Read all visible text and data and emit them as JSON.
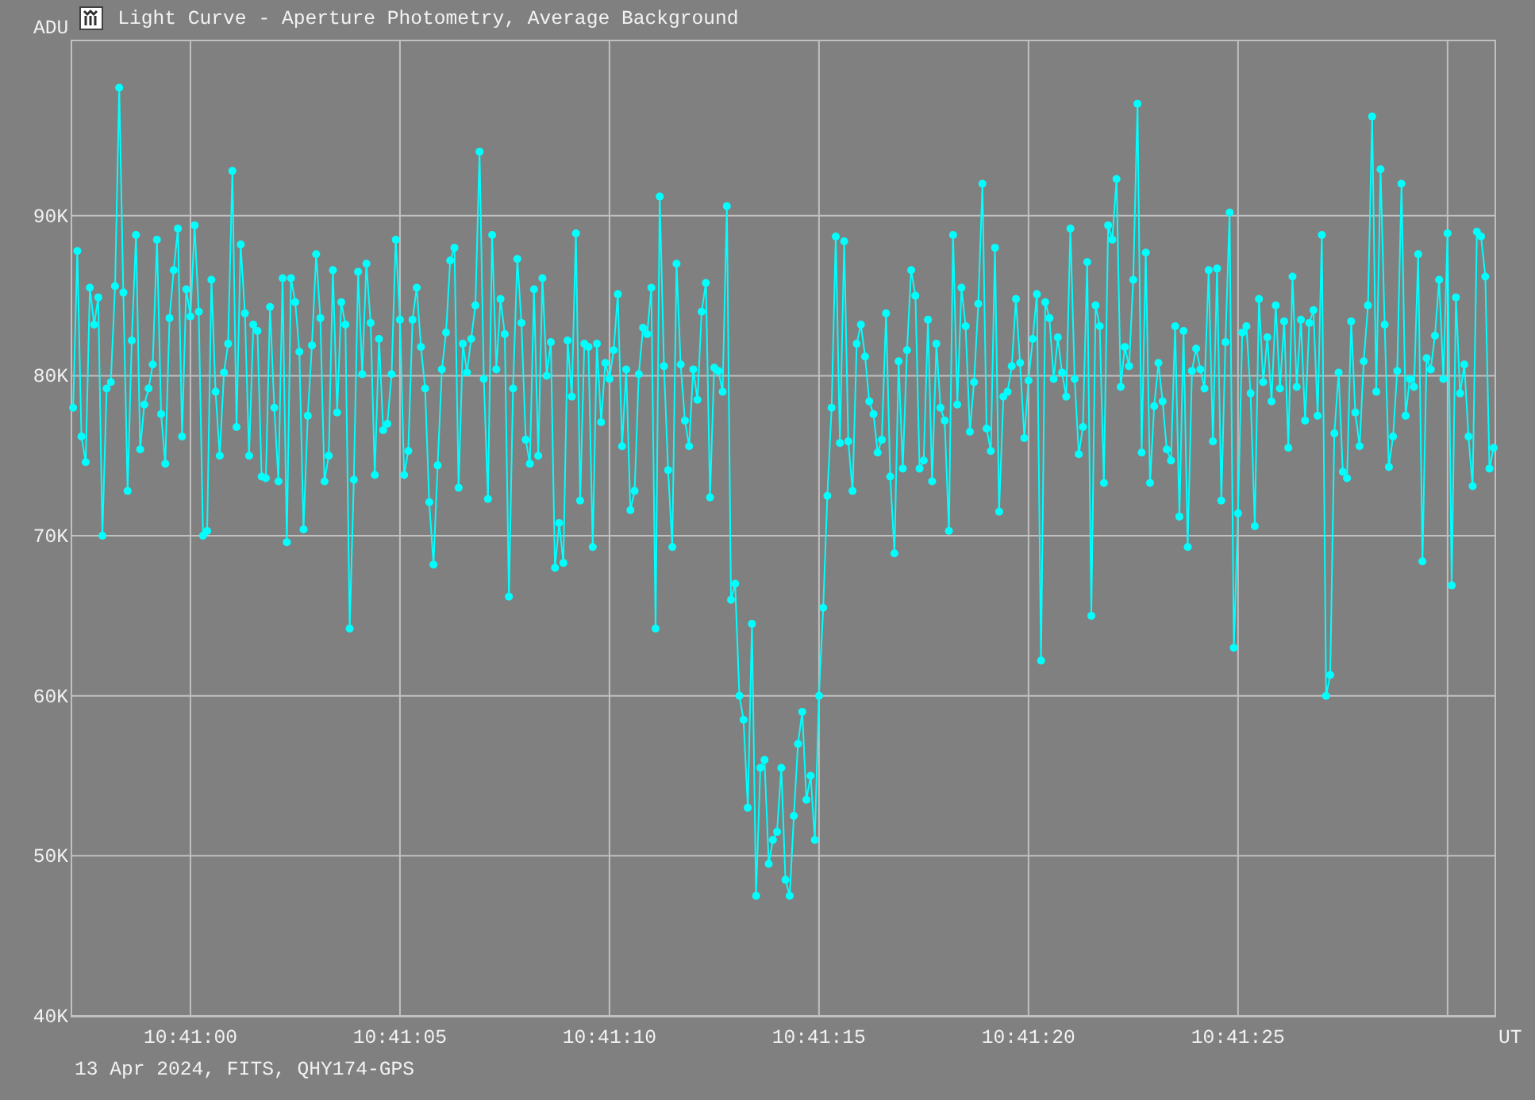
{
  "window": {
    "title": "Light Curve - Aperture Photometry, Average Background"
  },
  "chart": {
    "chart_data": {
      "type": "line",
      "xlabel": "UT",
      "ylabel": "ADU",
      "grid": true,
      "series": [
        {
          "color": "#00ffff",
          "marker": "circle",
          "values": [
            78000,
            87800,
            76200,
            74600,
            85500,
            83200,
            84900,
            70000,
            79200,
            79600,
            85600,
            98000,
            85200,
            72800,
            82200,
            88800,
            75400,
            78200,
            79200,
            80700,
            88500,
            77600,
            74500,
            83600,
            86600,
            89200,
            76200,
            85400,
            83700,
            89400,
            84000,
            70000,
            70300,
            86000,
            79000,
            75000,
            80200,
            82000,
            92800,
            76800,
            88200,
            83900,
            75000,
            83200,
            82800,
            73700,
            73600,
            84300,
            78000,
            73400,
            86100,
            69600,
            86100,
            84600,
            81500,
            70400,
            77500,
            81900,
            87600,
            83600,
            73400,
            75000,
            86600,
            77700,
            84600,
            83200,
            64200,
            73500,
            86500,
            80100,
            87000,
            83300,
            73800,
            82300,
            76600,
            77000,
            80100,
            88500,
            83500,
            73800,
            75300,
            83500,
            85500,
            81800,
            79200,
            72100,
            68200,
            74400,
            80400,
            82700,
            87200,
            88000,
            73000,
            82000,
            80200,
            82300,
            84400,
            94000,
            79800,
            72300,
            88800,
            80400,
            84800,
            82600,
            66200,
            79200,
            87300,
            83300,
            76000,
            74500,
            85400,
            75000,
            86100,
            80000,
            82100,
            68000,
            70800,
            68300,
            82200,
            78700,
            88900,
            72200,
            82000,
            81800,
            69300,
            82000,
            77100,
            80800,
            79800,
            81600,
            85100,
            75600,
            80400,
            71600,
            72800,
            80100,
            83000,
            82600,
            85500,
            64200,
            91200,
            80600,
            74100,
            69300,
            87000,
            80700,
            77200,
            75600,
            80400,
            78500,
            84000,
            85800,
            72400,
            80500,
            80300,
            79000,
            90600,
            66000,
            67000,
            60000,
            58500,
            53000,
            64500,
            47500,
            55500,
            56000,
            49500,
            51000,
            51500,
            55500,
            48500,
            47500,
            52500,
            57000,
            59000,
            53500,
            55000,
            51000,
            60000,
            65500,
            72500,
            78000,
            88700,
            75800,
            88400,
            75900,
            72800,
            82000,
            83200,
            81200,
            78400,
            77600,
            75200,
            76000,
            83900,
            73700,
            68900,
            80900,
            74200,
            81600,
            86600,
            85000,
            74200,
            74700,
            83500,
            73400,
            82000,
            78000,
            77200,
            70300,
            88800,
            78200,
            85500,
            83100,
            76500,
            79600,
            84500,
            92000,
            76700,
            75300,
            88000,
            71500,
            78700,
            79000,
            80600,
            84800,
            80800,
            76100,
            79700,
            82300,
            85100,
            62200,
            84600,
            83600,
            79800,
            82400,
            80200,
            78700,
            89200,
            79800,
            75100,
            76800,
            87100,
            65000,
            84400,
            83100,
            73300,
            89400,
            88500,
            92300,
            79300,
            81800,
            80600,
            86000,
            97000,
            75200,
            87700,
            73300,
            78100,
            80800,
            78400,
            75400,
            74700,
            83100,
            71200,
            82800,
            69300,
            80300,
            81700,
            80400,
            79200,
            86600,
            75900,
            86700,
            72200,
            82100,
            90200,
            63000,
            71400,
            82700,
            83100,
            78900,
            70600,
            84800,
            79600,
            82400,
            78400,
            84400,
            79200,
            83400,
            75500,
            86200,
            79300,
            83500,
            77200,
            83300,
            84100,
            77500,
            88800,
            60000,
            61300,
            76400,
            80200,
            74000,
            73600,
            83400,
            77700,
            75600,
            80900,
            84400,
            96200,
            79000,
            92900,
            83200,
            74300,
            76200,
            80300,
            92000,
            77500,
            79800,
            79300,
            87600,
            68400,
            81100,
            80400,
            82500,
            86000,
            79800,
            88900,
            66900,
            84900,
            78900,
            80700,
            76200,
            73100,
            89000,
            88700,
            86200,
            74200,
            75500
          ]
        }
      ],
      "ylim": [
        40000,
        101000
      ],
      "categories": [
        null,
        null,
        null,
        null,
        null,
        null,
        null,
        null,
        null,
        null,
        null,
        null,
        null,
        null,
        null,
        null,
        null,
        null,
        null,
        null,
        null,
        null,
        null,
        null,
        null,
        null,
        null,
        null,
        "10:41:00",
        null,
        null,
        null,
        null,
        null,
        null,
        null,
        null,
        null,
        null,
        null,
        null,
        null,
        null,
        null,
        null,
        null,
        null,
        null,
        null,
        null,
        null,
        null,
        null,
        null,
        null,
        null,
        null,
        null,
        null,
        null,
        null,
        null,
        null,
        null,
        null,
        null,
        null,
        null,
        null,
        null,
        null,
        null,
        null,
        null,
        null,
        null,
        null,
        null,
        "10:41:05",
        null,
        null,
        null,
        null,
        null,
        null,
        null,
        null,
        null,
        null,
        null,
        null,
        null,
        null,
        null,
        null,
        null,
        null,
        null,
        null,
        null,
        null,
        null,
        null,
        null,
        null,
        null,
        null,
        null,
        null,
        null,
        null,
        null,
        null,
        null,
        null,
        null,
        null,
        null,
        null,
        null,
        null,
        null,
        null,
        null,
        null,
        null,
        null,
        null,
        "10:41:10",
        null,
        null,
        null,
        null,
        null,
        null,
        null,
        null,
        null,
        null,
        null,
        null,
        null,
        null,
        null,
        null,
        null,
        null,
        null,
        null,
        null,
        null,
        null,
        null,
        null,
        null,
        null,
        null,
        null,
        null,
        null,
        null,
        null,
        null,
        null,
        null,
        null,
        null,
        null,
        null,
        null,
        null,
        null,
        null,
        null,
        null,
        null,
        null,
        null,
        "10:41:15",
        null,
        null,
        null,
        null,
        null,
        null,
        null,
        null,
        null,
        null,
        null,
        null,
        null,
        null,
        null,
        null,
        null,
        null,
        null,
        null,
        null,
        null,
        null,
        null,
        null,
        null,
        null,
        null,
        null,
        null,
        null,
        null,
        null,
        null,
        null,
        null,
        null,
        null,
        null,
        null,
        null,
        null,
        null,
        null,
        null,
        null,
        null,
        null,
        null,
        "10:41:20",
        null,
        null,
        null,
        null,
        null,
        null,
        null,
        null,
        null,
        null,
        null,
        null,
        null,
        null,
        null,
        null,
        null,
        null,
        null,
        null,
        null,
        null,
        null,
        null,
        null,
        null,
        null,
        null,
        null,
        null,
        null,
        null,
        null,
        null,
        null,
        null,
        null,
        null,
        null,
        null,
        null,
        null,
        null,
        null,
        null,
        null,
        null,
        null,
        null,
        "10:41:25",
        null,
        null,
        null,
        null,
        null,
        null,
        null,
        null,
        null,
        null,
        null,
        null,
        null,
        null,
        null,
        null,
        null,
        null,
        null,
        null,
        null,
        null,
        null,
        null,
        null,
        null,
        null,
        null,
        null,
        null,
        null,
        null,
        null,
        null,
        null,
        null,
        null,
        null,
        null,
        null,
        null,
        null,
        null,
        null,
        null,
        null,
        null,
        null,
        null,
        null,
        null,
        null,
        null,
        null,
        null,
        null,
        null,
        null,
        null,
        null,
        null
      ],
      "yticks": [
        {
          "value": 40000,
          "label": "40K"
        },
        {
          "value": 50000,
          "label": "50K"
        },
        {
          "value": 60000,
          "label": "60K"
        },
        {
          "value": 70000,
          "label": "70K"
        },
        {
          "value": 80000,
          "label": "80K"
        },
        {
          "value": 90000,
          "label": "90K"
        }
      ]
    }
  },
  "footer": "13 Apr 2024, FITS, QHY174-GPS"
}
